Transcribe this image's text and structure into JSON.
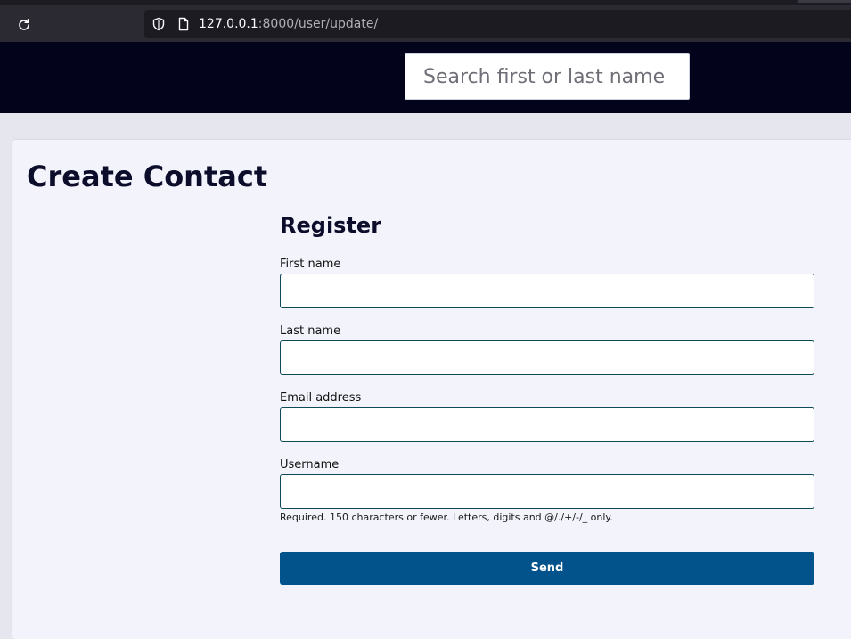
{
  "browser": {
    "url_host": "127.0.0.1",
    "url_rest": ":8000/user/update/"
  },
  "header": {
    "search_placeholder": "Search first or last name"
  },
  "page": {
    "title": "Create Contact"
  },
  "form": {
    "title": "Register",
    "fields": [
      {
        "label": "First name",
        "value": ""
      },
      {
        "label": "Last name",
        "value": ""
      },
      {
        "label": "Email address",
        "value": ""
      },
      {
        "label": "Username",
        "value": ""
      }
    ],
    "username_help": "Required. 150 characters or fewer. Letters, digits and @/./+/-/_ only.",
    "submit_label": "Send"
  },
  "colors": {
    "header_bg": "#03031c",
    "primary_button": "#02538b",
    "input_border": "#0d4a5a",
    "content_bg": "#f3f3fc"
  },
  "icons": {
    "reload": "reload-icon",
    "shield": "shield-icon",
    "page": "page-icon"
  }
}
